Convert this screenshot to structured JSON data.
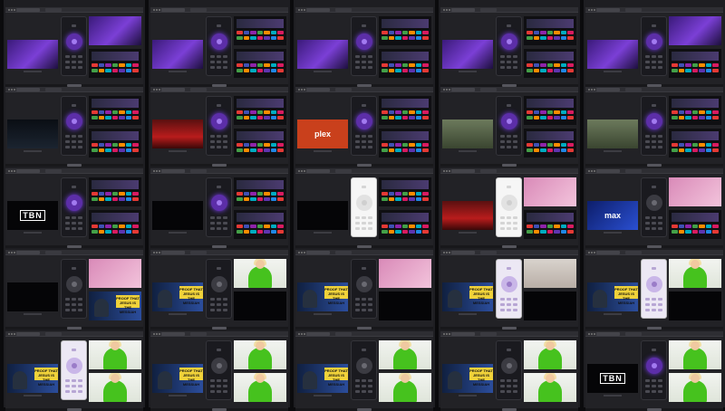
{
  "wall": {
    "columns": 5,
    "rows": 5,
    "brand_accent": "#7b3fd6"
  },
  "labels": {
    "tbn": "TBN",
    "plex": "plex",
    "max": "max",
    "proof": "PROOF THAT",
    "jesus": "JESUS IS THE",
    "messiah": "MESSIAH"
  },
  "cells": [
    [
      {
        "tv": "purple",
        "phone": "purple",
        "a": "purple",
        "b": "home"
      },
      {
        "tv": "purple",
        "phone": "purple",
        "a": "home",
        "b": "home"
      },
      {
        "tv": "purple",
        "phone": "purple",
        "a": "home",
        "b": "home"
      },
      {
        "tv": "purple",
        "phone": "purple",
        "a": "home",
        "b": "home"
      },
      {
        "tv": "purple",
        "phone": "purple",
        "a": "purple",
        "b": "home"
      }
    ],
    [
      {
        "tv": "night",
        "phone": "purple",
        "a": "home",
        "b": "home"
      },
      {
        "tv": "red",
        "phone": "purple",
        "a": "home",
        "b": "home"
      },
      {
        "tv": "plex",
        "phone": "purple",
        "a": "home",
        "b": "home"
      },
      {
        "tv": "field",
        "phone": "purple",
        "a": "home",
        "b": "home"
      },
      {
        "tv": "field",
        "phone": "purple",
        "a": "home",
        "b": "home"
      }
    ],
    [
      {
        "tv": "tbn",
        "phone": "purple",
        "a": "home",
        "b": "home"
      },
      {
        "tv": "dark",
        "phone": "purple",
        "a": "home",
        "b": "home"
      },
      {
        "tv": "dark",
        "phone": "white",
        "a": "home",
        "b": "home"
      },
      {
        "tv": "red",
        "phone": "white",
        "a": "pink",
        "b": "home"
      },
      {
        "tv": "max",
        "phone": "gray",
        "a": "pink",
        "b": "home"
      }
    ],
    [
      {
        "tv": "dark",
        "phone": "gray",
        "a": "pink",
        "b": "news"
      },
      {
        "tv": "news",
        "phone": "gray",
        "a": "green",
        "b": "dark"
      },
      {
        "tv": "news",
        "phone": "gray",
        "a": "pink",
        "b": "dark"
      },
      {
        "tv": "news",
        "phone": "light",
        "a": "studio",
        "b": "dark"
      },
      {
        "tv": "news",
        "phone": "light",
        "a": "green",
        "b": "dark"
      }
    ],
    [
      {
        "tv": "news",
        "phone": "light",
        "a": "green",
        "b": "green"
      },
      {
        "tv": "news",
        "phone": "gray",
        "a": "green",
        "b": "green"
      },
      {
        "tv": "news",
        "phone": "gray",
        "a": "green",
        "b": "green"
      },
      {
        "tv": "news",
        "phone": "gray",
        "a": "green",
        "b": "green"
      },
      {
        "tv": "tbn",
        "phone": "purple",
        "a": "green",
        "b": "green"
      }
    ]
  ]
}
